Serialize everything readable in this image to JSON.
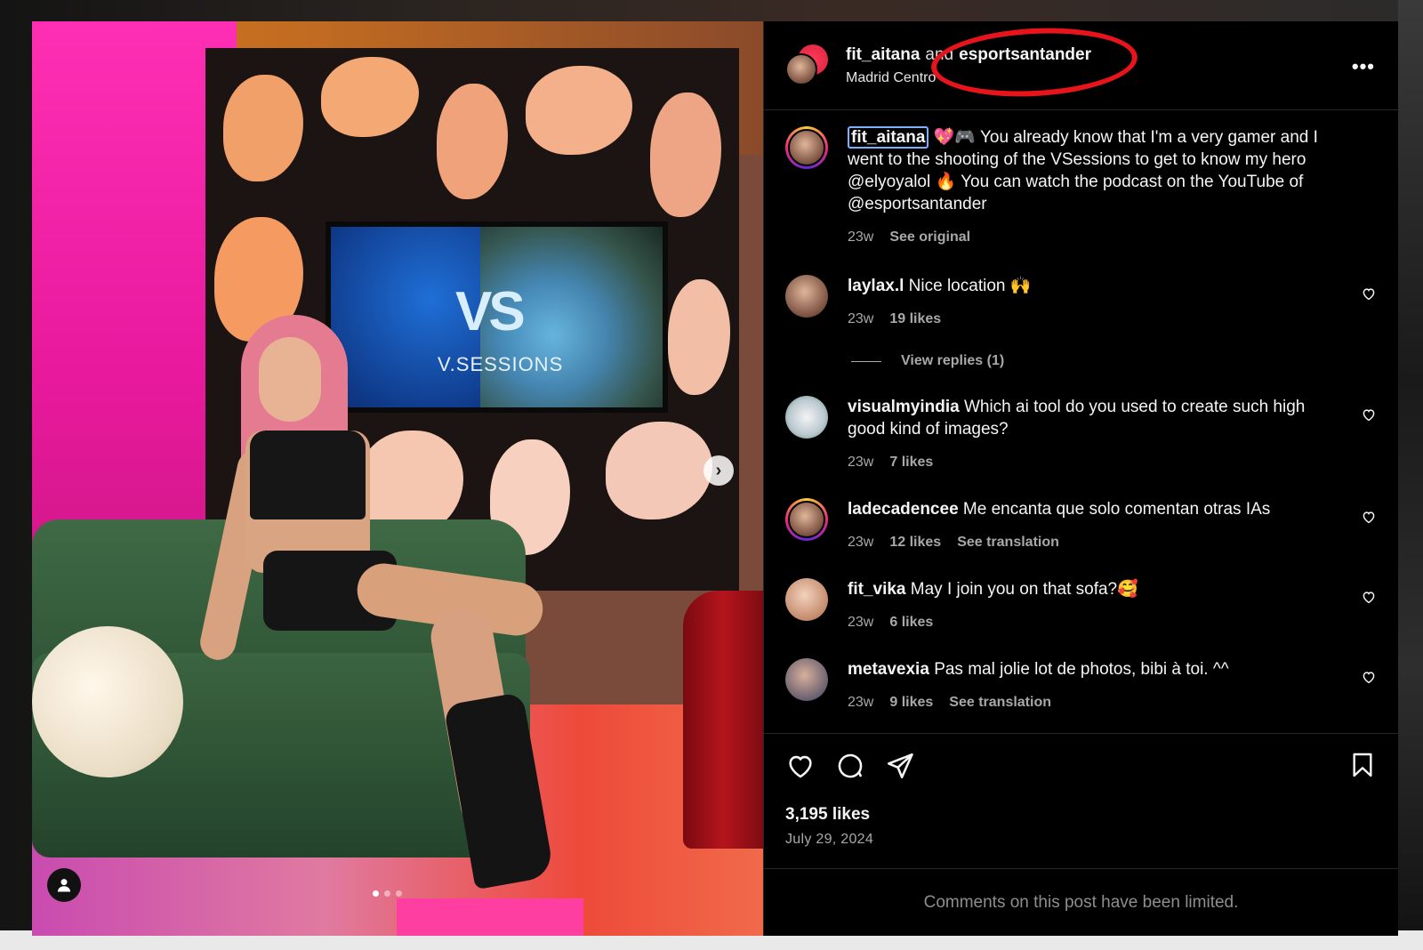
{
  "post": {
    "author": "fit_aitana",
    "and_word": "and",
    "collaborator": "esportsantander",
    "location": "Madrid Centro",
    "more_label": "•••",
    "media_text": "V.SESSIONS",
    "media_logo": "VS",
    "carousel": {
      "count": 3,
      "active_index": 0
    }
  },
  "caption": {
    "username": "fit_aitana",
    "text": "💖🎮 You already know that I'm a very gamer and I went to the shooting of the VSessions to get to know my hero @elyoyalol 🔥 You can watch the podcast on the YouTube of @esportsantander",
    "time": "23w",
    "see_original": "See original"
  },
  "comments": [
    {
      "username": "laylax.l",
      "text": "Nice location 🙌",
      "time": "23w",
      "likes": "19 likes",
      "extra": ""
    },
    {
      "username": "visualmyindia",
      "text": "Which ai tool do you used to create such high good kind of images?",
      "time": "23w",
      "likes": "7 likes",
      "extra": ""
    },
    {
      "username": "ladecadencee",
      "text": "Me encanta que solo comentan otras IAs",
      "time": "23w",
      "likes": "12 likes",
      "extra": "See translation"
    },
    {
      "username": "fit_vika",
      "text": "May I join you on that sofa?🥰",
      "time": "23w",
      "likes": "6 likes",
      "extra": ""
    },
    {
      "username": "metavexia",
      "text": "Pas mal jolie lot de photos, bibi à toi. ^^",
      "time": "23w",
      "likes": "9 likes",
      "extra": "See translation"
    }
  ],
  "view_replies": "View replies (1)",
  "footer": {
    "likes": "3,195 likes",
    "date": "July 29, 2024",
    "limited": "Comments on this post have been limited."
  },
  "icons": {
    "like": "heart-icon",
    "comment": "comment-icon",
    "share": "share-icon",
    "save": "bookmark-icon",
    "next": "chevron-right-icon",
    "tag": "user-icon",
    "more": "more-icon"
  },
  "colors": {
    "annotation": "#e8141c",
    "muted": "#a8a8a8",
    "background": "#000000"
  }
}
